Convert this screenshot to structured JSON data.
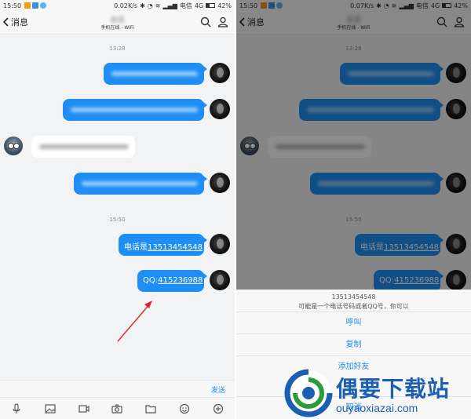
{
  "status_bar": {
    "time": "15:50",
    "left_speed": "0.02K/s",
    "right_speed": "0.07K/s",
    "carrier": "电信",
    "network": "4G",
    "battery": "42%"
  },
  "header": {
    "back_label": "消息",
    "contact_name": "会话",
    "contact_status": "手机在线 - WiFi"
  },
  "messages": {
    "ts1": "13:28",
    "ts2": "15:50",
    "phone_prefix": "电话是",
    "phone_number": "13513454548",
    "qq_prefix": "QQ:",
    "qq_number": "415236988"
  },
  "input": {
    "send_label": "发送"
  },
  "toolbar_icons": [
    "mic-icon",
    "image-icon",
    "video-icon",
    "camera-icon",
    "folder-icon",
    "emoji-icon",
    "plus-icon"
  ],
  "action_sheet": {
    "number": "13513454548",
    "description": "可能是一个电话号码或者QQ号，你可以",
    "options": [
      "呼叫",
      "复制",
      "添加好友",
      "取消"
    ]
  },
  "watermark": {
    "title": "偶要下载站",
    "url": "ouyaoxiazai.com"
  },
  "colors": {
    "accent": "#1e8ef5",
    "watermark": "#1a5fb4"
  }
}
